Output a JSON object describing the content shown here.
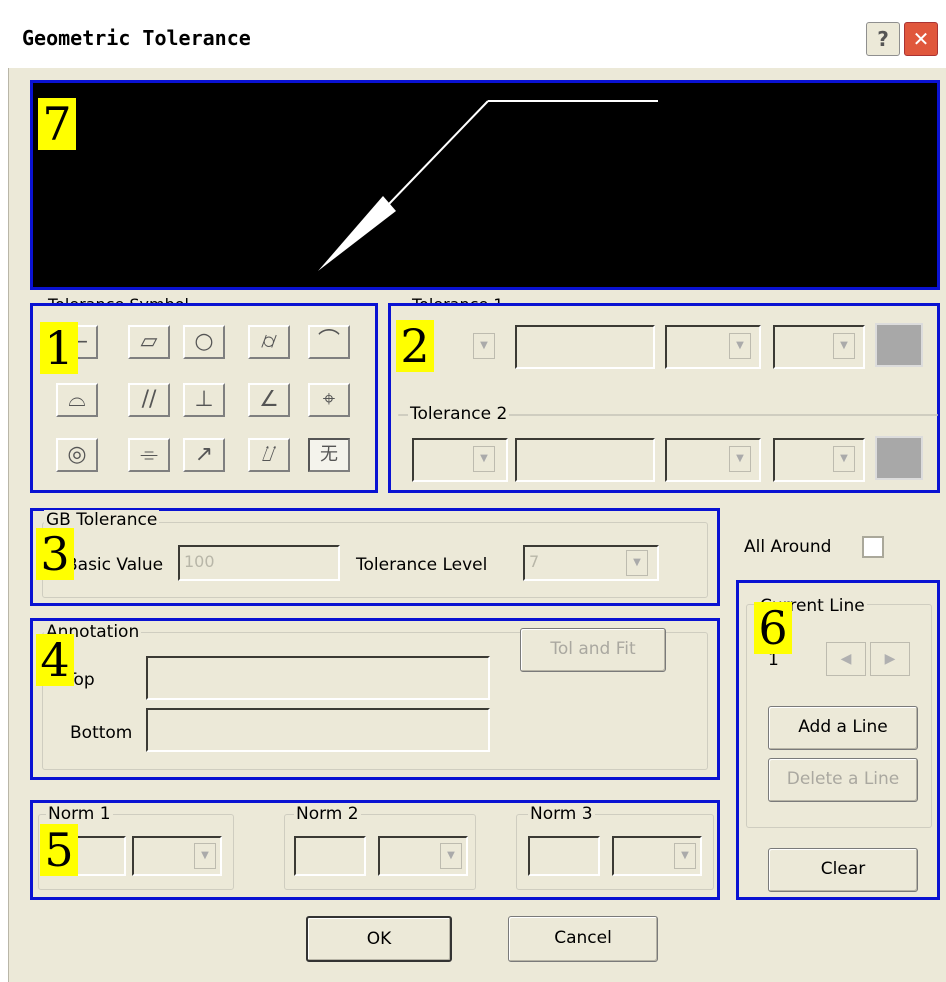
{
  "window": {
    "title": "Geometric Tolerance",
    "help_glyph": "?",
    "close_glyph": "✕"
  },
  "badges": {
    "b1": "1",
    "b2": "2",
    "b3": "3",
    "b4": "4",
    "b5": "5",
    "b6": "6",
    "b7": "7"
  },
  "tolerance_symbol": {
    "title": "Tolerance Symbol",
    "symbols": [
      "—",
      "▱",
      "○",
      "⌭",
      "⌒",
      "⌓",
      "//",
      "⊥",
      "∠",
      "⌖",
      "◎",
      "⌯",
      "↗",
      "⌰",
      "无"
    ]
  },
  "tolerance1": {
    "title": "Tolerance 1",
    "value": ""
  },
  "tolerance2": {
    "title": "Tolerance 2",
    "value": ""
  },
  "gb_tolerance": {
    "title": "GB Tolerance",
    "basic_value_label": "Basic Value",
    "basic_value": "100",
    "tolerance_level_label": "Tolerance Level",
    "tolerance_level": "7"
  },
  "all_around": {
    "label": "All Around"
  },
  "annotation": {
    "title": "Annotation",
    "top_label": "Top",
    "bottom_label": "Bottom",
    "tol_fit_label": "Tol and Fit"
  },
  "norms": {
    "norm1": "Norm 1",
    "norm2": "Norm 2",
    "norm3": "Norm 3"
  },
  "current_line": {
    "title": "Current Line",
    "value": "1",
    "add_label": "Add a Line",
    "delete_label": "Delete a Line",
    "clear_label": "Clear"
  },
  "footer": {
    "ok_label": "OK",
    "cancel_label": "Cancel"
  },
  "colors": {
    "highlight": "#0a12d2",
    "badge": "#ffff00",
    "dialog_bg": "#ece9d8"
  }
}
